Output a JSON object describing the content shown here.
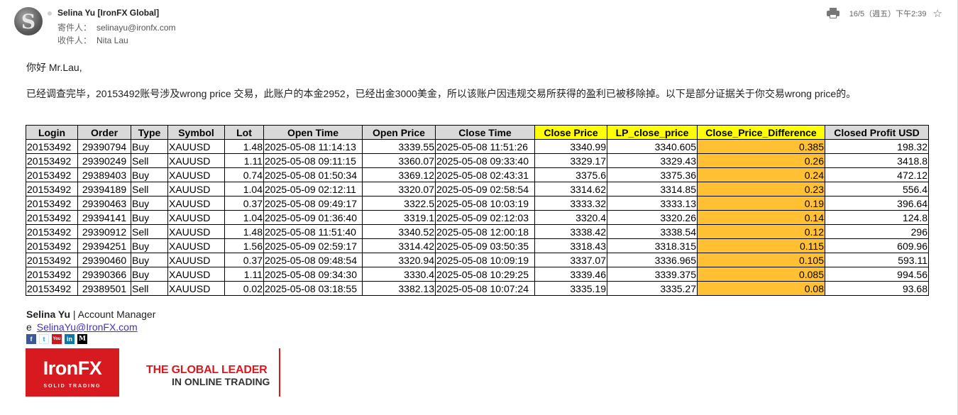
{
  "header": {
    "avatar_letter": "S",
    "sender": "Selina Yu [IronFX Global]",
    "from_label": "寄件人：",
    "from_value": "selinayu@ironfx.com",
    "to_label": "收件人：",
    "to_value": "Nita Lau",
    "date": "16/5（週五）下午2:39"
  },
  "body": {
    "greeting": "你好 Mr.Lau,",
    "message": "已经调查完毕，20153492账号涉及wrong price 交易，此账户的本金2952，已经出金3000美金，所以该账户因违规交易所获得的盈利已被移除掉。以下是部分证据关于你交易wrong price的。"
  },
  "table": {
    "headers": [
      "Login",
      "Order",
      "Type",
      "Symbol",
      "Lot",
      "Open Time",
      "Open Price",
      "Close Time",
      "Close Price",
      "LP_close_price",
      "Close_Price_Difference",
      "Closed Profit USD"
    ],
    "rows": [
      [
        "20153492",
        "29390794",
        "Buy",
        "XAUUSD",
        "1.48",
        "2025-05-08 11:14:13",
        "3339.55",
        "2025-05-08 11:51:26",
        "3340.99",
        "3340.605",
        "0.385",
        "198.32"
      ],
      [
        "20153492",
        "29390249",
        "Sell",
        "XAUUSD",
        "1.11",
        "2025-05-08 09:11:15",
        "3360.07",
        "2025-05-08 09:33:40",
        "3329.17",
        "3329.43",
        "0.26",
        "3418.8"
      ],
      [
        "20153492",
        "29389403",
        "Buy",
        "XAUUSD",
        "0.74",
        "2025-05-08 01:50:34",
        "3369.12",
        "2025-05-08 02:43:31",
        "3375.6",
        "3375.36",
        "0.24",
        "472.12"
      ],
      [
        "20153492",
        "29394189",
        "Sell",
        "XAUUSD",
        "1.04",
        "2025-05-09 02:12:11",
        "3320.07",
        "2025-05-09 02:58:54",
        "3314.62",
        "3314.85",
        "0.23",
        "556.4"
      ],
      [
        "20153492",
        "29390463",
        "Buy",
        "XAUUSD",
        "0.37",
        "2025-05-08 09:49:17",
        "3322.5",
        "2025-05-08 10:03:19",
        "3333.32",
        "3333.13",
        "0.19",
        "396.64"
      ],
      [
        "20153492",
        "29394141",
        "Buy",
        "XAUUSD",
        "1.04",
        "2025-05-09 01:36:40",
        "3319.1",
        "2025-05-09 02:12:03",
        "3320.4",
        "3320.26",
        "0.14",
        "124.8"
      ],
      [
        "20153492",
        "29390912",
        "Sell",
        "XAUUSD",
        "1.48",
        "2025-05-08 11:51:40",
        "3340.52",
        "2025-05-08 12:00:18",
        "3338.42",
        "3338.54",
        "0.12",
        "296"
      ],
      [
        "20153492",
        "29394251",
        "Buy",
        "XAUUSD",
        "1.56",
        "2025-05-09 02:59:17",
        "3314.42",
        "2025-05-09 03:50:35",
        "3318.43",
        "3318.315",
        "0.115",
        "609.96"
      ],
      [
        "20153492",
        "29390460",
        "Buy",
        "XAUUSD",
        "0.37",
        "2025-05-08 09:48:54",
        "3320.94",
        "2025-05-08 10:09:19",
        "3337.07",
        "3336.965",
        "0.105",
        "593.11"
      ],
      [
        "20153492",
        "29390366",
        "Buy",
        "XAUUSD",
        "1.11",
        "2025-05-08 09:34:30",
        "3330.4",
        "2025-05-08 10:29:25",
        "3339.46",
        "3339.375",
        "0.085",
        "994.56"
      ],
      [
        "20153492",
        "29389501",
        "Sell",
        "XAUUSD",
        "0.02",
        "2025-05-08 03:18:55",
        "3382.13",
        "2025-05-08 10:07:24",
        "3335.19",
        "3335.27",
        "0.08",
        "93.68"
      ]
    ]
  },
  "signature": {
    "name": "Selina Yu",
    "title": " | Account Manager",
    "email_prefix": "e",
    "email": "SelinaYu@IronFX.com",
    "social": [
      {
        "name": "facebook-icon",
        "glyph": "f"
      },
      {
        "name": "twitter-icon",
        "glyph": "t"
      },
      {
        "name": "youtube-icon",
        "glyph": "You"
      },
      {
        "name": "linkedin-icon",
        "glyph": "in"
      },
      {
        "name": "medium-icon",
        "glyph": "M"
      }
    ],
    "logo_main": "IronFX",
    "logo_sub": "SOLID TRADING",
    "tagline_1": "THE GLOBAL LEADER",
    "tagline_2": "IN ONLINE TRADING"
  },
  "colors": {
    "header_gray": "#d9d9d9",
    "header_yellow": "#ffff00",
    "diff_orange": "#ffc133",
    "brand_red": "#d71920",
    "link_purple": "#4a2ec6"
  }
}
